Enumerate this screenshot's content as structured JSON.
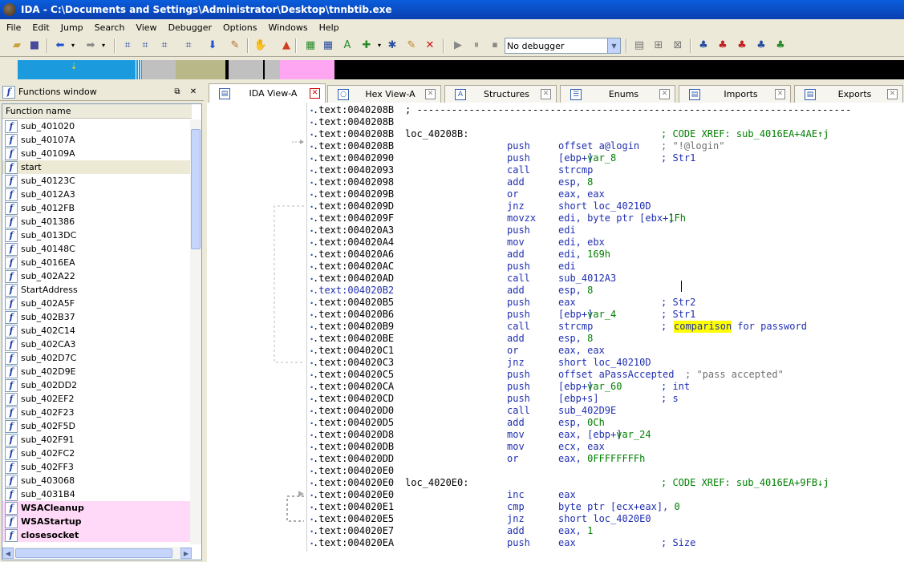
{
  "window": {
    "title": "IDA - C:\\Documents and Settings\\Administrator\\Desktop\\tnnbtib.exe"
  },
  "menu": [
    "File",
    "Edit",
    "Jump",
    "Search",
    "View",
    "Debugger",
    "Options",
    "Windows",
    "Help"
  ],
  "toolbar": {
    "debugger_select": "No debugger"
  },
  "colors": {
    "title_bar": "#0a4fd0",
    "import_highlight": "#ffd9f7",
    "code_blue": "#1f2fb0",
    "code_green": "#008000",
    "search_highlight": "#ffff00",
    "nav_library": "#1b9bde",
    "nav_data": "#b8b888",
    "nav_external": "#ffa6f2",
    "nav_unexplored": "#c0c0c0"
  },
  "functions_window": {
    "title": "Functions window",
    "column_header": "Function name",
    "selected": "start",
    "functions": [
      {
        "name": "sub_401020",
        "import": false
      },
      {
        "name": "sub_40107A",
        "import": false
      },
      {
        "name": "sub_40109A",
        "import": false
      },
      {
        "name": "start",
        "import": false
      },
      {
        "name": "sub_40123C",
        "import": false
      },
      {
        "name": "sub_4012A3",
        "import": false
      },
      {
        "name": "sub_4012FB",
        "import": false
      },
      {
        "name": "sub_401386",
        "import": false
      },
      {
        "name": "sub_4013DC",
        "import": false
      },
      {
        "name": "sub_40148C",
        "import": false
      },
      {
        "name": "sub_4016EA",
        "import": false
      },
      {
        "name": "sub_402A22",
        "import": false
      },
      {
        "name": "StartAddress",
        "import": false
      },
      {
        "name": "sub_402A5F",
        "import": false
      },
      {
        "name": "sub_402B37",
        "import": false
      },
      {
        "name": "sub_402C14",
        "import": false
      },
      {
        "name": "sub_402CA3",
        "import": false
      },
      {
        "name": "sub_402D7C",
        "import": false
      },
      {
        "name": "sub_402D9E",
        "import": false
      },
      {
        "name": "sub_402DD2",
        "import": false
      },
      {
        "name": "sub_402EF2",
        "import": false
      },
      {
        "name": "sub_402F23",
        "import": false
      },
      {
        "name": "sub_402F5D",
        "import": false
      },
      {
        "name": "sub_402F91",
        "import": false
      },
      {
        "name": "sub_402FC2",
        "import": false
      },
      {
        "name": "sub_402FF3",
        "import": false
      },
      {
        "name": "sub_403068",
        "import": false
      },
      {
        "name": "sub_4031B4",
        "import": false
      },
      {
        "name": "WSACleanup",
        "import": true
      },
      {
        "name": "WSAStartup",
        "import": true
      },
      {
        "name": "closesocket",
        "import": true
      }
    ]
  },
  "tabs": [
    {
      "label": "IDA View-A",
      "active": true
    },
    {
      "label": "Hex View-A",
      "active": false
    },
    {
      "label": "Structures",
      "active": false
    },
    {
      "label": "Enums",
      "active": false
    },
    {
      "label": "Imports",
      "active": false
    },
    {
      "label": "Exports",
      "active": false
    }
  ],
  "disassembly": {
    "lines": [
      {
        "addr": ".text:0040208B",
        "label": "; ---------------------------------------------------------------------------",
        "sep": true
      },
      {
        "addr": ".text:0040208B"
      },
      {
        "addr": ".text:0040208B",
        "label": "loc_40208B:",
        "comment": "; CODE XREF: sub_4016EA+4AE↑j",
        "xref": true
      },
      {
        "addr": ".text:0040208B",
        "mnem": "push",
        "oper": "offset a@login",
        "comment": "; \"!@login\"",
        "gray": true
      },
      {
        "addr": ".text:00402090",
        "mnem": "push",
        "oper": "[ebp+var_8]",
        "comment": "; Str1"
      },
      {
        "addr": ".text:00402093",
        "mnem": "call",
        "oper": "strcmp"
      },
      {
        "addr": ".text:00402098",
        "mnem": "add",
        "oper": "esp, 8"
      },
      {
        "addr": ".text:0040209B",
        "mnem": "or",
        "oper": "eax, eax"
      },
      {
        "addr": ".text:0040209D",
        "mnem": "jnz",
        "oper": "short loc_40210D"
      },
      {
        "addr": ".text:0040209F",
        "mnem": "movzx",
        "oper": "edi, byte ptr [ebx+1Fh]"
      },
      {
        "addr": ".text:004020A3",
        "mnem": "push",
        "oper": "edi"
      },
      {
        "addr": ".text:004020A4",
        "mnem": "mov",
        "oper": "edi, ebx"
      },
      {
        "addr": ".text:004020A6",
        "mnem": "add",
        "oper": "edi, 169h"
      },
      {
        "addr": ".text:004020AC",
        "mnem": "push",
        "oper": "edi"
      },
      {
        "addr": ".text:004020AD",
        "mnem": "call",
        "oper": "sub_4012A3"
      },
      {
        "addr": ".text:004020B2",
        "mnem": "add",
        "oper": "esp, 8",
        "hl": true
      },
      {
        "addr": ".text:004020B5",
        "mnem": "push",
        "oper": "eax",
        "comment": "; Str2"
      },
      {
        "addr": ".text:004020B6",
        "mnem": "push",
        "oper": "[ebp+var_4]",
        "comment": "; Str1"
      },
      {
        "addr": ".text:004020B9",
        "mnem": "call",
        "oper": "strcmp",
        "comment": "; ",
        "highlight": "comparison",
        "comment_tail": " for password"
      },
      {
        "addr": ".text:004020BE",
        "mnem": "add",
        "oper": "esp, 8"
      },
      {
        "addr": ".text:004020C1",
        "mnem": "or",
        "oper": "eax, eax"
      },
      {
        "addr": ".text:004020C3",
        "mnem": "jnz",
        "oper": "short loc_40210D"
      },
      {
        "addr": ".text:004020C5",
        "mnem": "push",
        "oper": "offset aPassAccepted",
        "comment": "; \"pass accepted\"",
        "gray": true
      },
      {
        "addr": ".text:004020CA",
        "mnem": "push",
        "oper": "[ebp+var_60]",
        "comment": "; int"
      },
      {
        "addr": ".text:004020CD",
        "mnem": "push",
        "oper": "[ebp+s]",
        "comment": "; s"
      },
      {
        "addr": ".text:004020D0",
        "mnem": "call",
        "oper": "sub_402D9E"
      },
      {
        "addr": ".text:004020D5",
        "mnem": "add",
        "oper": "esp, 0Ch"
      },
      {
        "addr": ".text:004020D8",
        "mnem": "mov",
        "oper": "eax, [ebp+var_24]"
      },
      {
        "addr": ".text:004020DB",
        "mnem": "mov",
        "oper": "ecx, eax"
      },
      {
        "addr": ".text:004020DD",
        "mnem": "or",
        "oper": "eax, 0FFFFFFFFh"
      },
      {
        "addr": ".text:004020E0"
      },
      {
        "addr": ".text:004020E0",
        "label": "loc_4020E0:",
        "comment": "; CODE XREF: sub_4016EA+9FB↓j",
        "xref": true
      },
      {
        "addr": ".text:004020E0",
        "mnem": "inc",
        "oper": "eax"
      },
      {
        "addr": ".text:004020E1",
        "mnem": "cmp",
        "oper": "byte ptr [ecx+eax], 0"
      },
      {
        "addr": ".text:004020E5",
        "mnem": "jnz",
        "oper": "short loc_4020E0"
      },
      {
        "addr": ".text:004020E7",
        "mnem": "add",
        "oper": "eax, 1"
      },
      {
        "addr": ".text:004020EA",
        "mnem": "push",
        "oper": "eax",
        "comment": "; Size"
      }
    ]
  }
}
